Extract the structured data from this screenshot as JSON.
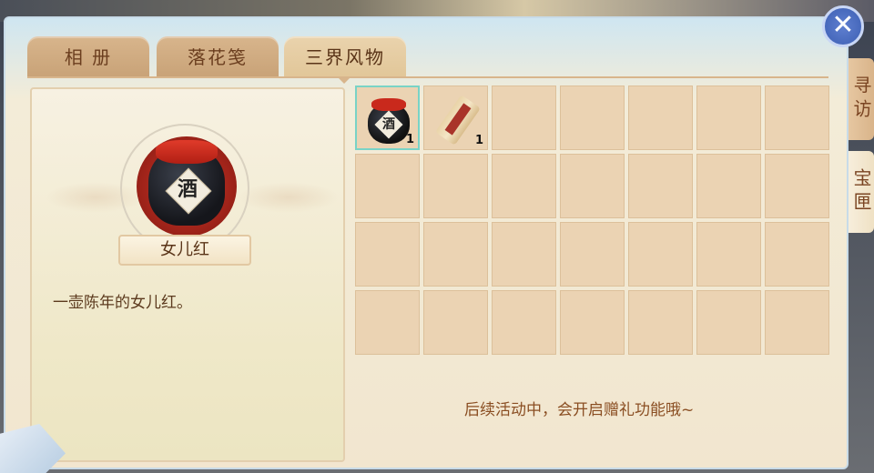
{
  "tabs": [
    {
      "label": "相 册",
      "active": false
    },
    {
      "label": "落花笺",
      "active": false
    },
    {
      "label": "三界风物",
      "active": true
    }
  ],
  "side_tabs": [
    {
      "label": "寻访",
      "active": false
    },
    {
      "label": "宝匣",
      "active": true
    }
  ],
  "detail": {
    "item_icon": "wine-jar-icon",
    "item_char": "酒",
    "item_name": "女儿红",
    "description": "一壶陈年的女儿红。"
  },
  "inventory": {
    "slots": [
      {
        "icon": "wine-jar-icon",
        "char": "酒",
        "count": "1",
        "selected": true
      },
      {
        "icon": "scroll-icon",
        "count": "1",
        "selected": false
      }
    ],
    "empty_slot_count": 26
  },
  "hint_text": "后续活动中，会开启赠礼功能哦~",
  "colors": {
    "accent": "#79d3c6",
    "text_brown": "#5a3418",
    "close_button": "#4a6fc2"
  }
}
